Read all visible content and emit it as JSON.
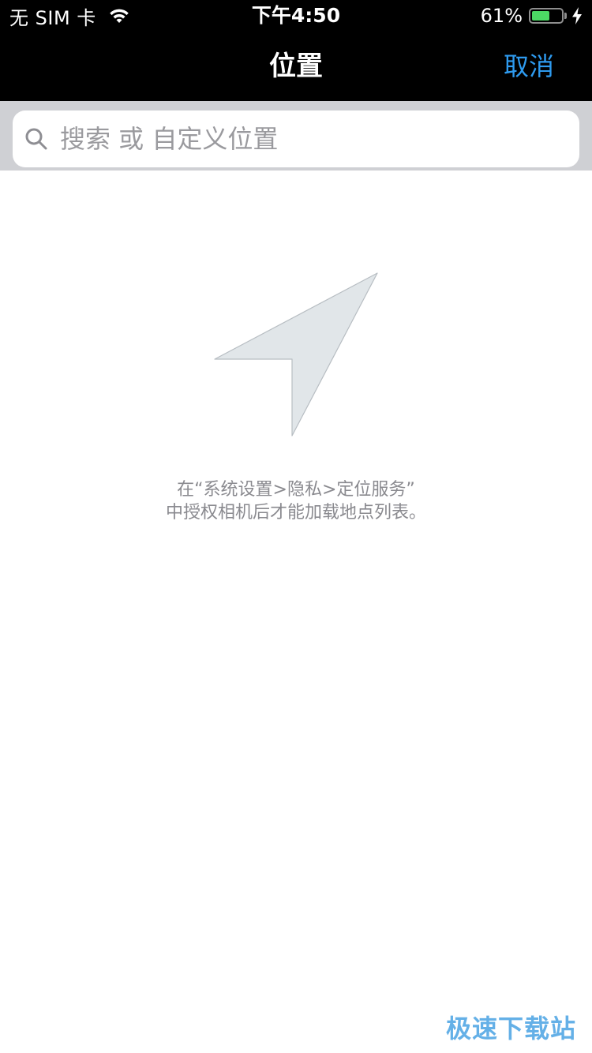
{
  "status_bar": {
    "carrier": "无 SIM 卡",
    "time": "下午4:50",
    "battery_percent": "61%",
    "battery_level": 0.61,
    "battery_color": "#4cd964"
  },
  "nav": {
    "title": "位置",
    "cancel_label": "取消",
    "accent_color": "#2e9bf0"
  },
  "search": {
    "placeholder": "搜索 或 自定义位置",
    "value": "",
    "icon": "search-icon"
  },
  "empty_state": {
    "icon": "location-arrow-icon",
    "line1": "在“系统设置>隐私>定位服务”",
    "line2": "中授权相机后才能加载地点列表。"
  },
  "watermark": {
    "text": "极速下载站"
  }
}
